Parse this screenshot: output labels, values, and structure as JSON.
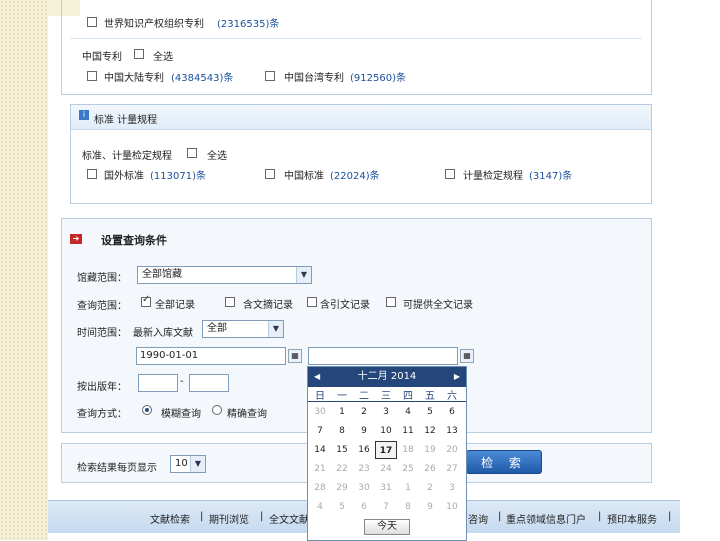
{
  "patent": {
    "wipo": {
      "label": "世界知识产权组织专利",
      "count": "(2316535)条"
    },
    "china_title": "中国专利",
    "select_all": "全选",
    "mainland": {
      "label": "中国大陆专利",
      "count": "(4384543)条"
    },
    "taiwan": {
      "label": "中国台湾专利",
      "count": "(912560)条"
    }
  },
  "standards": {
    "section_title": "标准  计量规程",
    "group_title": "标准、计量检定规程",
    "select_all": "全选",
    "foreign": {
      "label": "国外标准",
      "count": "(113071)条"
    },
    "china": {
      "label": "中国标准",
      "count": "(22024)条"
    },
    "metrology": {
      "label": "计量检定规程",
      "count": "(3147)条"
    }
  },
  "query": {
    "title": "设置查询条件",
    "collection_label": "馆藏范围：",
    "collection_value": "全部馆藏",
    "scope_label": "查询范围：",
    "scope_all": "全部记录",
    "scope_abstract": "含文摘记录",
    "scope_citation": "含引文记录",
    "scope_fulltext": "可提供全文记录",
    "time_label": "时间范围：",
    "time_newest": "最新入库文献",
    "time_select": "全部",
    "date_from": "1990-01-01",
    "date_to": "",
    "year_label": "按出版年：",
    "year_dash": "-",
    "mode_label": "查询方式：",
    "mode_fuzzy": "模糊查询",
    "mode_exact": "精确查询"
  },
  "results": {
    "per_page_label": "检索结果每页显示",
    "per_page_value": "10",
    "search_button": "检 索"
  },
  "calendar": {
    "title": "十二月 2014",
    "prev": "◀",
    "next": "▶",
    "weekdays": [
      "日",
      "一",
      "二",
      "三",
      "四",
      "五",
      "六"
    ],
    "rows": [
      [
        "30",
        "1",
        "2",
        "3",
        "4",
        "5",
        "6"
      ],
      [
        "7",
        "8",
        "9",
        "10",
        "11",
        "12",
        "13"
      ],
      [
        "14",
        "15",
        "16",
        "17",
        "18",
        "19",
        "20"
      ],
      [
        "21",
        "22",
        "23",
        "24",
        "25",
        "26",
        "27"
      ],
      [
        "28",
        "29",
        "30",
        "31",
        "1",
        "2",
        "3"
      ],
      [
        "4",
        "5",
        "6",
        "7",
        "8",
        "9",
        "10"
      ]
    ],
    "today_label": "今天"
  },
  "footer": {
    "items": [
      "文献检索",
      "|",
      "期刊浏览",
      "|",
      "全文文献",
      "咨询",
      "|",
      "重点领域信息门户",
      "|",
      "预印本服务",
      "|"
    ]
  }
}
